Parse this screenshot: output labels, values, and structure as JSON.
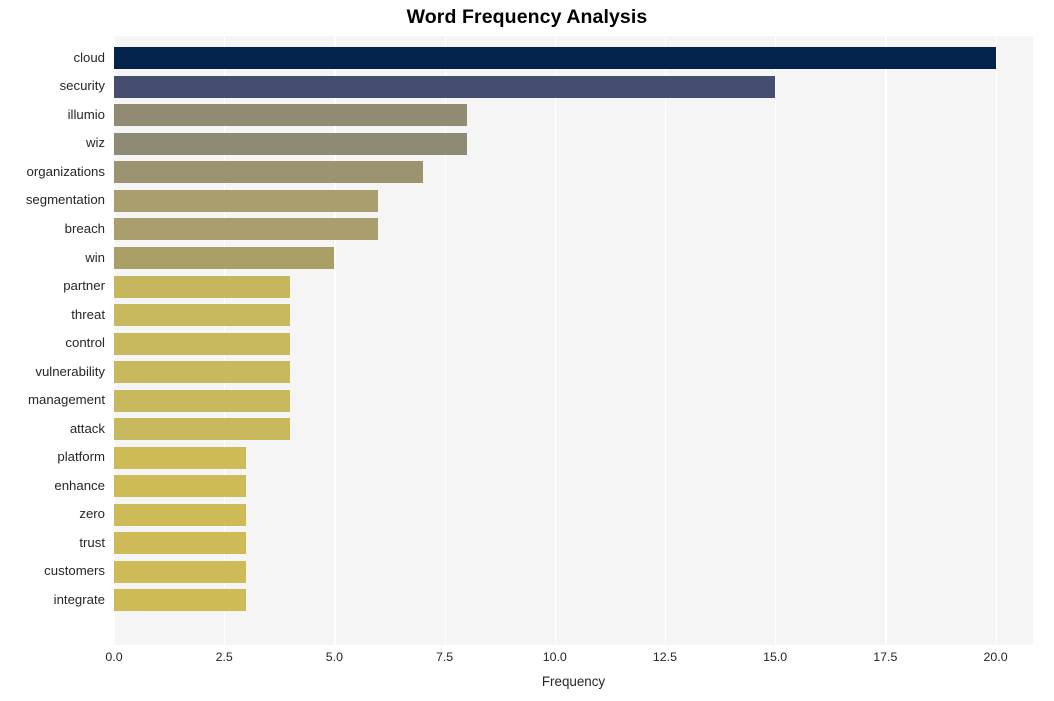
{
  "chart_data": {
    "type": "bar",
    "orientation": "horizontal",
    "title": "Word Frequency Analysis",
    "xlabel": "Frequency",
    "ylabel": "",
    "categories": [
      "cloud",
      "security",
      "illumio",
      "wiz",
      "organizations",
      "segmentation",
      "breach",
      "win",
      "partner",
      "threat",
      "control",
      "vulnerability",
      "management",
      "attack",
      "platform",
      "enhance",
      "zero",
      "trust",
      "customers",
      "integrate"
    ],
    "values": [
      20,
      15,
      8,
      8,
      7,
      6,
      6,
      5,
      4,
      4,
      4,
      4,
      4,
      4,
      3,
      3,
      3,
      3,
      3,
      3
    ],
    "bar_colors": [
      "#04234c",
      "#454e70",
      "#918b73",
      "#8f8a74",
      "#9c9470",
      "#a89e6e",
      "#a89e6e",
      "#ab9f68",
      "#c6b75e",
      "#c9b95e",
      "#c9b95e",
      "#c9b95e",
      "#c9b95e",
      "#c9b95e",
      "#ceba57",
      "#ceba57",
      "#ceba57",
      "#ceba57",
      "#ceba57",
      "#ceba57"
    ],
    "xlim": [
      0,
      20.85
    ],
    "xticks": [
      0,
      2.5,
      5,
      7.5,
      10,
      12.5,
      15,
      17.5,
      20
    ],
    "xtick_labels": [
      "0.0",
      "2.5",
      "5.0",
      "7.5",
      "10.0",
      "12.5",
      "15.0",
      "17.5",
      "20.0"
    ],
    "grid": "vertical-only",
    "legend": "none",
    "plot_background": "#f5f5f6",
    "gridline_color": "#ffffff",
    "figure_background": "#ffffff",
    "style": "whitegrid"
  }
}
